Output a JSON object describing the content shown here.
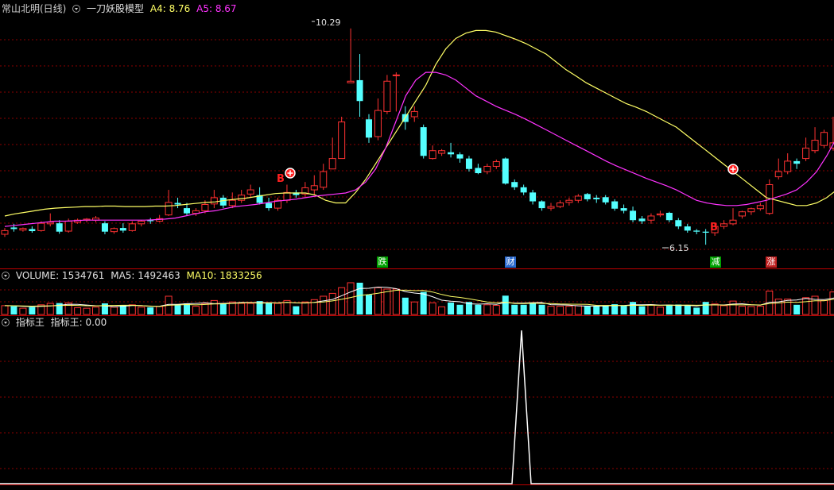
{
  "header_main": {
    "stock": "常山北明(日线)",
    "indicator": "一刀妖股模型",
    "a4": "A4: 8.76",
    "a5": "A5: 8.67"
  },
  "header_volume": {
    "label": "VOLUME: 1534761",
    "ma5": "MA5: 1492463",
    "ma10": "MA10: 1833256"
  },
  "header_indicator": {
    "name": "指标王",
    "value": "指标王: 0.00"
  },
  "annotations": {
    "high": "10.29",
    "low": "6.15",
    "b1": "B",
    "b2": "B"
  },
  "tags": [
    {
      "text": "跌",
      "color": "#00a000"
    },
    {
      "text": "财",
      "color": "#2a6ad0"
    },
    {
      "text": "减",
      "color": "#00a000"
    },
    {
      "text": "涨",
      "color": "#c02020"
    }
  ],
  "colors": {
    "up": "#ff3232",
    "down": "#54ffff",
    "a4": "#ffff66",
    "a5": "#ff33ff",
    "grid": "#8b0000",
    "separator": "#c00000",
    "indicator_line": "#ffffff"
  },
  "chart_data": {
    "type": "candlestick",
    "price_range": [
      6.0,
      10.5
    ],
    "candles": [
      [
        6.35,
        6.47,
        6.42,
        6.3
      ],
      [
        6.48,
        6.55,
        6.45,
        6.4
      ],
      [
        6.43,
        6.48,
        6.46,
        6.4
      ],
      [
        6.45,
        6.5,
        6.41,
        6.38
      ],
      [
        6.42,
        6.6,
        6.56,
        6.4
      ],
      [
        6.55,
        6.75,
        6.58,
        6.5
      ],
      [
        6.56,
        6.62,
        6.4,
        6.36
      ],
      [
        6.41,
        6.65,
        6.6,
        6.38
      ],
      [
        6.58,
        6.65,
        6.62,
        6.55
      ],
      [
        6.62,
        6.66,
        6.64,
        6.58
      ],
      [
        6.62,
        6.7,
        6.66,
        6.58
      ],
      [
        6.56,
        6.6,
        6.4,
        6.35
      ],
      [
        6.4,
        6.48,
        6.46,
        6.36
      ],
      [
        6.47,
        6.56,
        6.42,
        6.38
      ],
      [
        6.42,
        6.6,
        6.55,
        6.4
      ],
      [
        6.55,
        6.62,
        6.6,
        6.5
      ],
      [
        6.62,
        6.66,
        6.6,
        6.55
      ],
      [
        6.6,
        6.72,
        6.65,
        6.58
      ],
      [
        6.72,
        7.2,
        6.96,
        6.7
      ],
      [
        6.95,
        7.05,
        6.92,
        6.85
      ],
      [
        6.85,
        6.95,
        6.75,
        6.7
      ],
      [
        6.75,
        6.85,
        6.8,
        6.7
      ],
      [
        6.8,
        7.0,
        6.92,
        6.75
      ],
      [
        6.93,
        7.2,
        7.05,
        6.85
      ],
      [
        7.05,
        7.1,
        6.9,
        6.85
      ],
      [
        6.9,
        7.15,
        7.0,
        6.85
      ],
      [
        7.0,
        7.2,
        7.1,
        6.95
      ],
      [
        7.12,
        7.3,
        7.2,
        7.05
      ],
      [
        7.1,
        7.25,
        6.95,
        6.92
      ],
      [
        6.95,
        7.05,
        6.85,
        6.8
      ],
      [
        6.85,
        7.05,
        7.0,
        6.8
      ],
      [
        7.0,
        7.3,
        7.15,
        6.95
      ],
      [
        7.15,
        7.2,
        7.1,
        7.05
      ],
      [
        7.12,
        7.35,
        7.24,
        7.05
      ],
      [
        7.2,
        7.48,
        7.28,
        7.1
      ],
      [
        7.25,
        7.7,
        7.55,
        7.2
      ],
      [
        7.6,
        8.2,
        7.8,
        7.6
      ],
      [
        7.8,
        8.6,
        8.5,
        7.8
      ],
      [
        9.25,
        10.29,
        9.28,
        9.25
      ],
      [
        9.3,
        9.8,
        8.9,
        8.6
      ],
      [
        8.55,
        8.65,
        8.2,
        8.1
      ],
      [
        8.22,
        8.95,
        8.72,
        8.15
      ],
      [
        8.7,
        9.4,
        9.28,
        8.65
      ],
      [
        9.4,
        9.45,
        9.4,
        8.7
      ],
      [
        8.65,
        8.8,
        8.5,
        8.35
      ],
      [
        8.6,
        8.8,
        8.7,
        8.5
      ],
      [
        8.4,
        8.45,
        7.85,
        7.8
      ],
      [
        7.8,
        8.05,
        7.95,
        7.78
      ],
      [
        7.9,
        7.98,
        7.95,
        7.85
      ],
      [
        7.92,
        8.1,
        7.88,
        7.82
      ],
      [
        7.88,
        7.92,
        7.8,
        7.72
      ],
      [
        7.8,
        7.85,
        7.6,
        7.55
      ],
      [
        7.62,
        7.7,
        7.52,
        7.5
      ],
      [
        7.55,
        7.7,
        7.65,
        7.5
      ],
      [
        7.65,
        7.78,
        7.74,
        7.6
      ],
      [
        7.8,
        7.82,
        7.32,
        7.3
      ],
      [
        7.35,
        7.4,
        7.25,
        7.2
      ],
      [
        7.25,
        7.3,
        7.15,
        7.1
      ],
      [
        7.15,
        7.2,
        6.98,
        6.92
      ],
      [
        6.98,
        7.0,
        6.85,
        6.8
      ],
      [
        6.85,
        6.95,
        6.88,
        6.8
      ],
      [
        6.88,
        7.0,
        6.95,
        6.85
      ],
      [
        6.96,
        7.05,
        7.0,
        6.9
      ],
      [
        7.0,
        7.12,
        7.08,
        6.95
      ],
      [
        7.12,
        7.14,
        7.02,
        6.98
      ],
      [
        7.05,
        7.1,
        7.02,
        6.95
      ],
      [
        7.06,
        7.1,
        6.96,
        6.92
      ],
      [
        6.98,
        7.02,
        6.84,
        6.8
      ],
      [
        6.85,
        6.92,
        6.8,
        6.75
      ],
      [
        6.8,
        6.88,
        6.62,
        6.58
      ],
      [
        6.65,
        6.7,
        6.6,
        6.55
      ],
      [
        6.62,
        6.75,
        6.7,
        6.55
      ],
      [
        6.72,
        6.8,
        6.74,
        6.68
      ],
      [
        6.76,
        6.78,
        6.62,
        6.58
      ],
      [
        6.62,
        6.66,
        6.5,
        6.45
      ],
      [
        6.5,
        6.55,
        6.42,
        6.38
      ],
      [
        6.42,
        6.45,
        6.4,
        6.35
      ],
      [
        6.4,
        6.45,
        6.38,
        6.15
      ],
      [
        6.38,
        6.55,
        6.5,
        6.32
      ],
      [
        6.5,
        6.62,
        6.55,
        6.45
      ],
      [
        6.55,
        6.85,
        6.62,
        6.52
      ],
      [
        6.7,
        6.8,
        6.78,
        6.65
      ],
      [
        6.78,
        6.86,
        6.84,
        6.72
      ],
      [
        6.84,
        6.95,
        6.9,
        6.8
      ],
      [
        6.75,
        7.4,
        7.3,
        6.72
      ],
      [
        7.45,
        7.8,
        7.55,
        7.4
      ],
      [
        7.55,
        7.9,
        7.75,
        7.5
      ],
      [
        7.75,
        7.8,
        7.7,
        7.6
      ],
      [
        7.8,
        8.2,
        8.0,
        7.75
      ],
      [
        7.95,
        8.4,
        8.15,
        7.9
      ],
      [
        8.05,
        8.35,
        8.3,
        8.0
      ],
      [
        8.0,
        8.6,
        8.1,
        7.95
      ],
      [
        8.1,
        8.85,
        8.8,
        8.05
      ],
      [
        8.85,
        9.1,
        8.55,
        8.25
      ],
      [
        8.45,
        8.5,
        8.35,
        8.15
      ],
      [
        8.35,
        8.45,
        8.32,
        8.15
      ],
      [
        8.15,
        8.3,
        8.22,
        8.1
      ],
      [
        8.25,
        8.35,
        8.3,
        8.2
      ],
      [
        8.2,
        8.55,
        8.4,
        8.15
      ]
    ],
    "a4": [
      6.7,
      6.74,
      6.77,
      6.8,
      6.83,
      6.85,
      6.86,
      6.87,
      6.88,
      6.88,
      6.89,
      6.89,
      6.88,
      6.88,
      6.88,
      6.89,
      6.89,
      6.9,
      6.92,
      6.94,
      6.96,
      6.97,
      7.0,
      7.02,
      7.04,
      7.07,
      7.1,
      7.13,
      7.14,
      7.14,
      7.14,
      7.1,
      7.0,
      6.95,
      6.95,
      7.15,
      7.4,
      7.7,
      8.0,
      8.3,
      8.6,
      8.9,
      9.2,
      9.6,
      9.9,
      10.1,
      10.2,
      10.25,
      10.25,
      10.22,
      10.15,
      10.08,
      10.0,
      9.9,
      9.8,
      9.65,
      9.5,
      9.38,
      9.25,
      9.15,
      9.05,
      8.95,
      8.85,
      8.78,
      8.7,
      8.6,
      8.5,
      8.4,
      8.25,
      8.1,
      7.95,
      7.8,
      7.65,
      7.5,
      7.35,
      7.2,
      7.05,
      7.0,
      6.95,
      6.9,
      6.9,
      6.95,
      7.05,
      7.2,
      7.4,
      7.65,
      7.9,
      8.1,
      8.3,
      8.5
    ],
    "a5": [
      6.5,
      6.52,
      6.54,
      6.56,
      6.58,
      6.6,
      6.6,
      6.61,
      6.62,
      6.62,
      6.62,
      6.62,
      6.62,
      6.62,
      6.62,
      6.63,
      6.64,
      6.66,
      6.7,
      6.74,
      6.78,
      6.8,
      6.84,
      6.88,
      6.9,
      6.92,
      6.95,
      6.98,
      7.0,
      7.02,
      7.05,
      7.08,
      7.1,
      7.12,
      7.14,
      7.2,
      7.35,
      7.6,
      8.0,
      8.5,
      9.0,
      9.3,
      9.45,
      9.45,
      9.4,
      9.3,
      9.15,
      9.0,
      8.9,
      8.8,
      8.72,
      8.64,
      8.55,
      8.45,
      8.35,
      8.25,
      8.15,
      8.05,
      7.95,
      7.85,
      7.75,
      7.66,
      7.58,
      7.5,
      7.42,
      7.35,
      7.28,
      7.2,
      7.1,
      7.0,
      6.95,
      6.92,
      6.9,
      6.9,
      6.92,
      6.96,
      7.0,
      7.06,
      7.12,
      7.2,
      7.35,
      7.55,
      7.85,
      8.2,
      8.5,
      8.75,
      8.9,
      8.95,
      8.9,
      8.8
    ]
  }
}
